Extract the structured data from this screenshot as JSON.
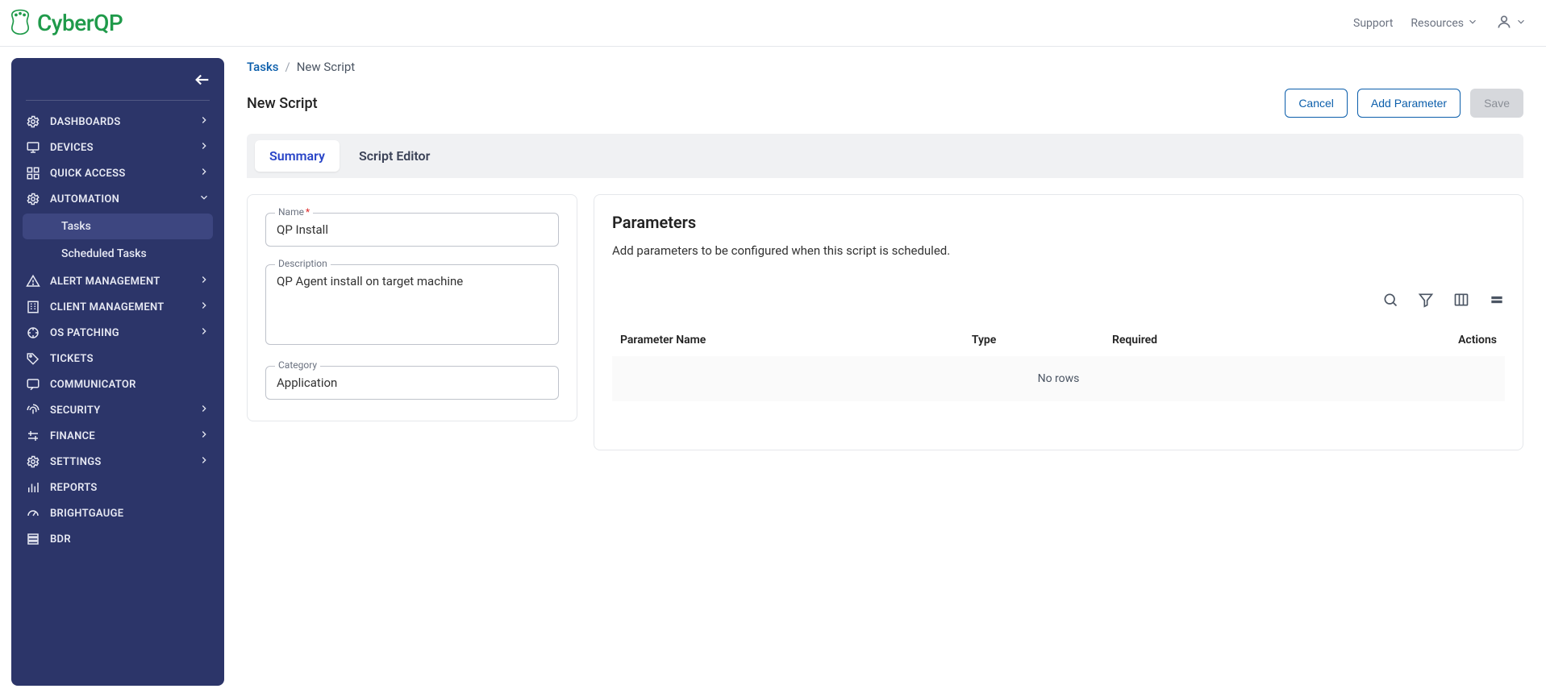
{
  "brand": {
    "name": "CyberQP"
  },
  "header": {
    "support": "Support",
    "resources": "Resources"
  },
  "sidebar": {
    "items": [
      {
        "label": "DASHBOARDS",
        "icon": "gear-icon",
        "expandable": true
      },
      {
        "label": "DEVICES",
        "icon": "monitor-icon",
        "expandable": true
      },
      {
        "label": "QUICK ACCESS",
        "icon": "grid-icon",
        "expandable": true
      },
      {
        "label": "AUTOMATION",
        "icon": "gear-icon",
        "expandable": true,
        "expanded": true,
        "children": [
          {
            "label": "Tasks",
            "active": true
          },
          {
            "label": "Scheduled Tasks",
            "active": false
          }
        ]
      },
      {
        "label": "ALERT MANAGEMENT",
        "icon": "alert-icon",
        "expandable": true
      },
      {
        "label": "CLIENT MANAGEMENT",
        "icon": "building-icon",
        "expandable": true
      },
      {
        "label": "OS PATCHING",
        "icon": "patch-icon",
        "expandable": true
      },
      {
        "label": "TICKETS",
        "icon": "tag-icon",
        "expandable": false
      },
      {
        "label": "COMMUNICATOR",
        "icon": "chat-icon",
        "expandable": false
      },
      {
        "label": "SECURITY",
        "icon": "fingerprint-icon",
        "expandable": true
      },
      {
        "label": "FINANCE",
        "icon": "finance-icon",
        "expandable": true
      },
      {
        "label": "SETTINGS",
        "icon": "gear-icon",
        "expandable": true
      },
      {
        "label": "REPORTS",
        "icon": "bars-icon",
        "expandable": false
      },
      {
        "label": "BRIGHTGAUGE",
        "icon": "gauge-icon",
        "expandable": false
      },
      {
        "label": "BDR",
        "icon": "stack-icon",
        "expandable": false
      }
    ]
  },
  "breadcrumb": {
    "root": "Tasks",
    "current": "New Script"
  },
  "page": {
    "title": "New Script",
    "actions": {
      "cancel": "Cancel",
      "add_parameter": "Add Parameter",
      "save": "Save"
    }
  },
  "tabs": [
    {
      "label": "Summary",
      "active": true
    },
    {
      "label": "Script Editor",
      "active": false
    }
  ],
  "form": {
    "name_label": "Name",
    "name_value": "QP Install",
    "description_label": "Description",
    "description_value": "QP Agent install on target machine",
    "category_label": "Category",
    "category_value": "Application"
  },
  "parameters": {
    "title": "Parameters",
    "description": "Add parameters to be configured when this script is scheduled.",
    "columns": {
      "name": "Parameter Name",
      "type": "Type",
      "required": "Required",
      "actions": "Actions"
    },
    "rows": [],
    "empty_text": "No rows"
  }
}
